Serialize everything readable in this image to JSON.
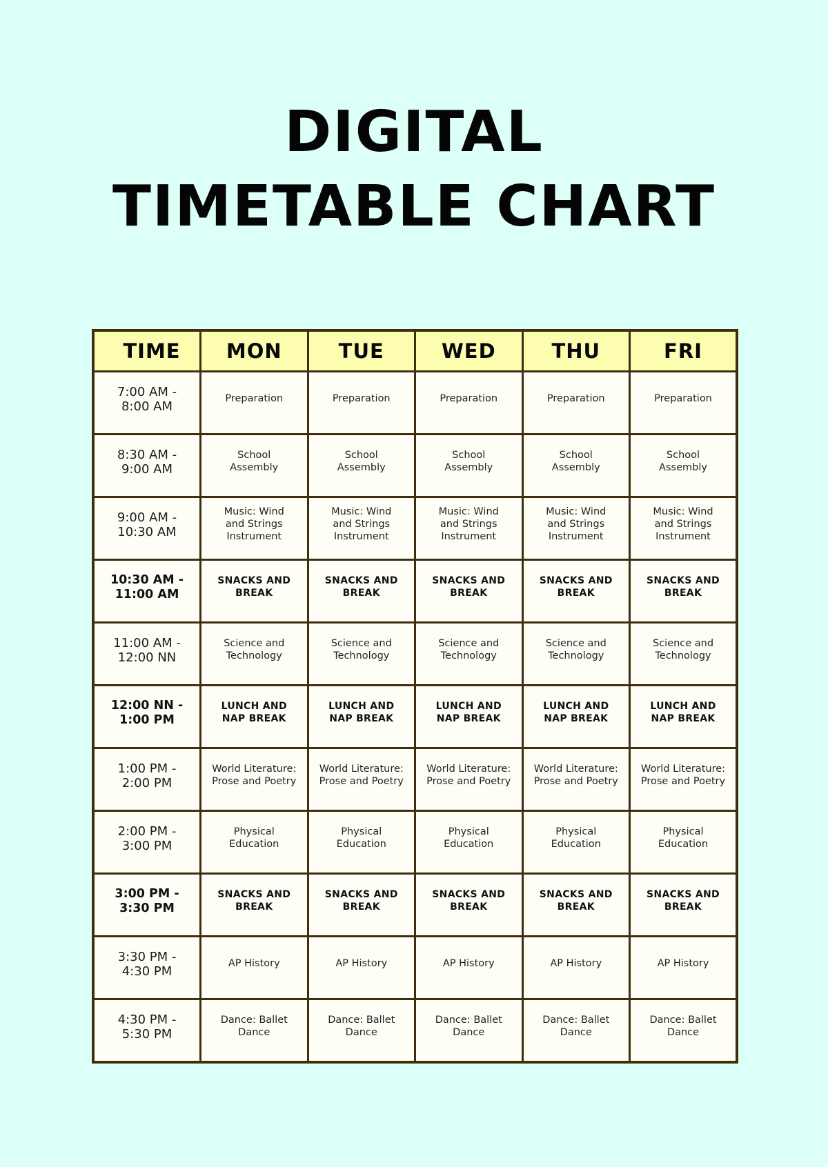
{
  "title": {
    "line1": "DIGITAL",
    "line2": "TIMETABLE CHART"
  },
  "colors": {
    "background": "#dcfff8",
    "header_fill": "#fdfdb0",
    "cell_fill": "#fffef6",
    "border": "#3f2e0e"
  },
  "timetable": {
    "headers": [
      "TIME",
      "MON",
      "TUE",
      "WED",
      "THU",
      "FRI"
    ],
    "rows": [
      {
        "time": "7:00 AM -\n8:00 AM",
        "is_break": false,
        "cells": [
          "Preparation",
          "Preparation",
          "Preparation",
          "Preparation",
          "Preparation"
        ]
      },
      {
        "time": "8:30 AM -\n9:00 AM",
        "is_break": false,
        "cells": [
          "School\nAssembly",
          "School\nAssembly",
          "School\nAssembly",
          "School\nAssembly",
          "School\nAssembly"
        ]
      },
      {
        "time": "9:00 AM -\n10:30 AM",
        "is_break": false,
        "cells": [
          "Music: Wind\nand Strings\nInstrument",
          "Music: Wind\nand Strings\nInstrument",
          "Music: Wind\nand Strings\nInstrument",
          "Music: Wind\nand Strings\nInstrument",
          "Music: Wind\nand Strings\nInstrument"
        ]
      },
      {
        "time": "10:30 AM -\n11:00 AM",
        "is_break": true,
        "cells": [
          "SNACKS AND\nBREAK",
          "SNACKS AND\nBREAK",
          "SNACKS AND\nBREAK",
          "SNACKS AND\nBREAK",
          "SNACKS AND\nBREAK"
        ]
      },
      {
        "time": "11:00 AM -\n12:00 NN",
        "is_break": false,
        "cells": [
          "Science and\nTechnology",
          "Science and\nTechnology",
          "Science and\nTechnology",
          "Science and\nTechnology",
          "Science and\nTechnology"
        ]
      },
      {
        "time": "12:00 NN -\n1:00 PM",
        "is_break": true,
        "cells": [
          "LUNCH AND\nNAP BREAK",
          "LUNCH AND\nNAP BREAK",
          "LUNCH AND\nNAP BREAK",
          "LUNCH AND\nNAP BREAK",
          "LUNCH AND\nNAP BREAK"
        ]
      },
      {
        "time": "1:00 PM -\n2:00 PM",
        "is_break": false,
        "cells": [
          "World Literature:\nProse and Poetry",
          "World Literature:\nProse and Poetry",
          "World Literature:\nProse and Poetry",
          "World Literature:\nProse and Poetry",
          "World Literature:\nProse and Poetry"
        ]
      },
      {
        "time": "2:00 PM -\n3:00 PM",
        "is_break": false,
        "cells": [
          "Physical\nEducation",
          "Physical\nEducation",
          "Physical\nEducation",
          "Physical\nEducation",
          "Physical\nEducation"
        ]
      },
      {
        "time": "3:00 PM -\n3:30 PM",
        "is_break": true,
        "cells": [
          "SNACKS AND\nBREAK",
          "SNACKS AND\nBREAK",
          "SNACKS AND\nBREAK",
          "SNACKS AND\nBREAK",
          "SNACKS AND\nBREAK"
        ]
      },
      {
        "time": "3:30 PM -\n4:30 PM",
        "is_break": false,
        "cells": [
          "AP History",
          "AP History",
          "AP History",
          "AP History",
          "AP History"
        ]
      },
      {
        "time": "4:30 PM -\n5:30 PM",
        "is_break": false,
        "cells": [
          "Dance: Ballet\nDance",
          "Dance: Ballet\nDance",
          "Dance: Ballet\nDance",
          "Dance: Ballet\nDance",
          "Dance: Ballet\nDance"
        ]
      }
    ]
  }
}
